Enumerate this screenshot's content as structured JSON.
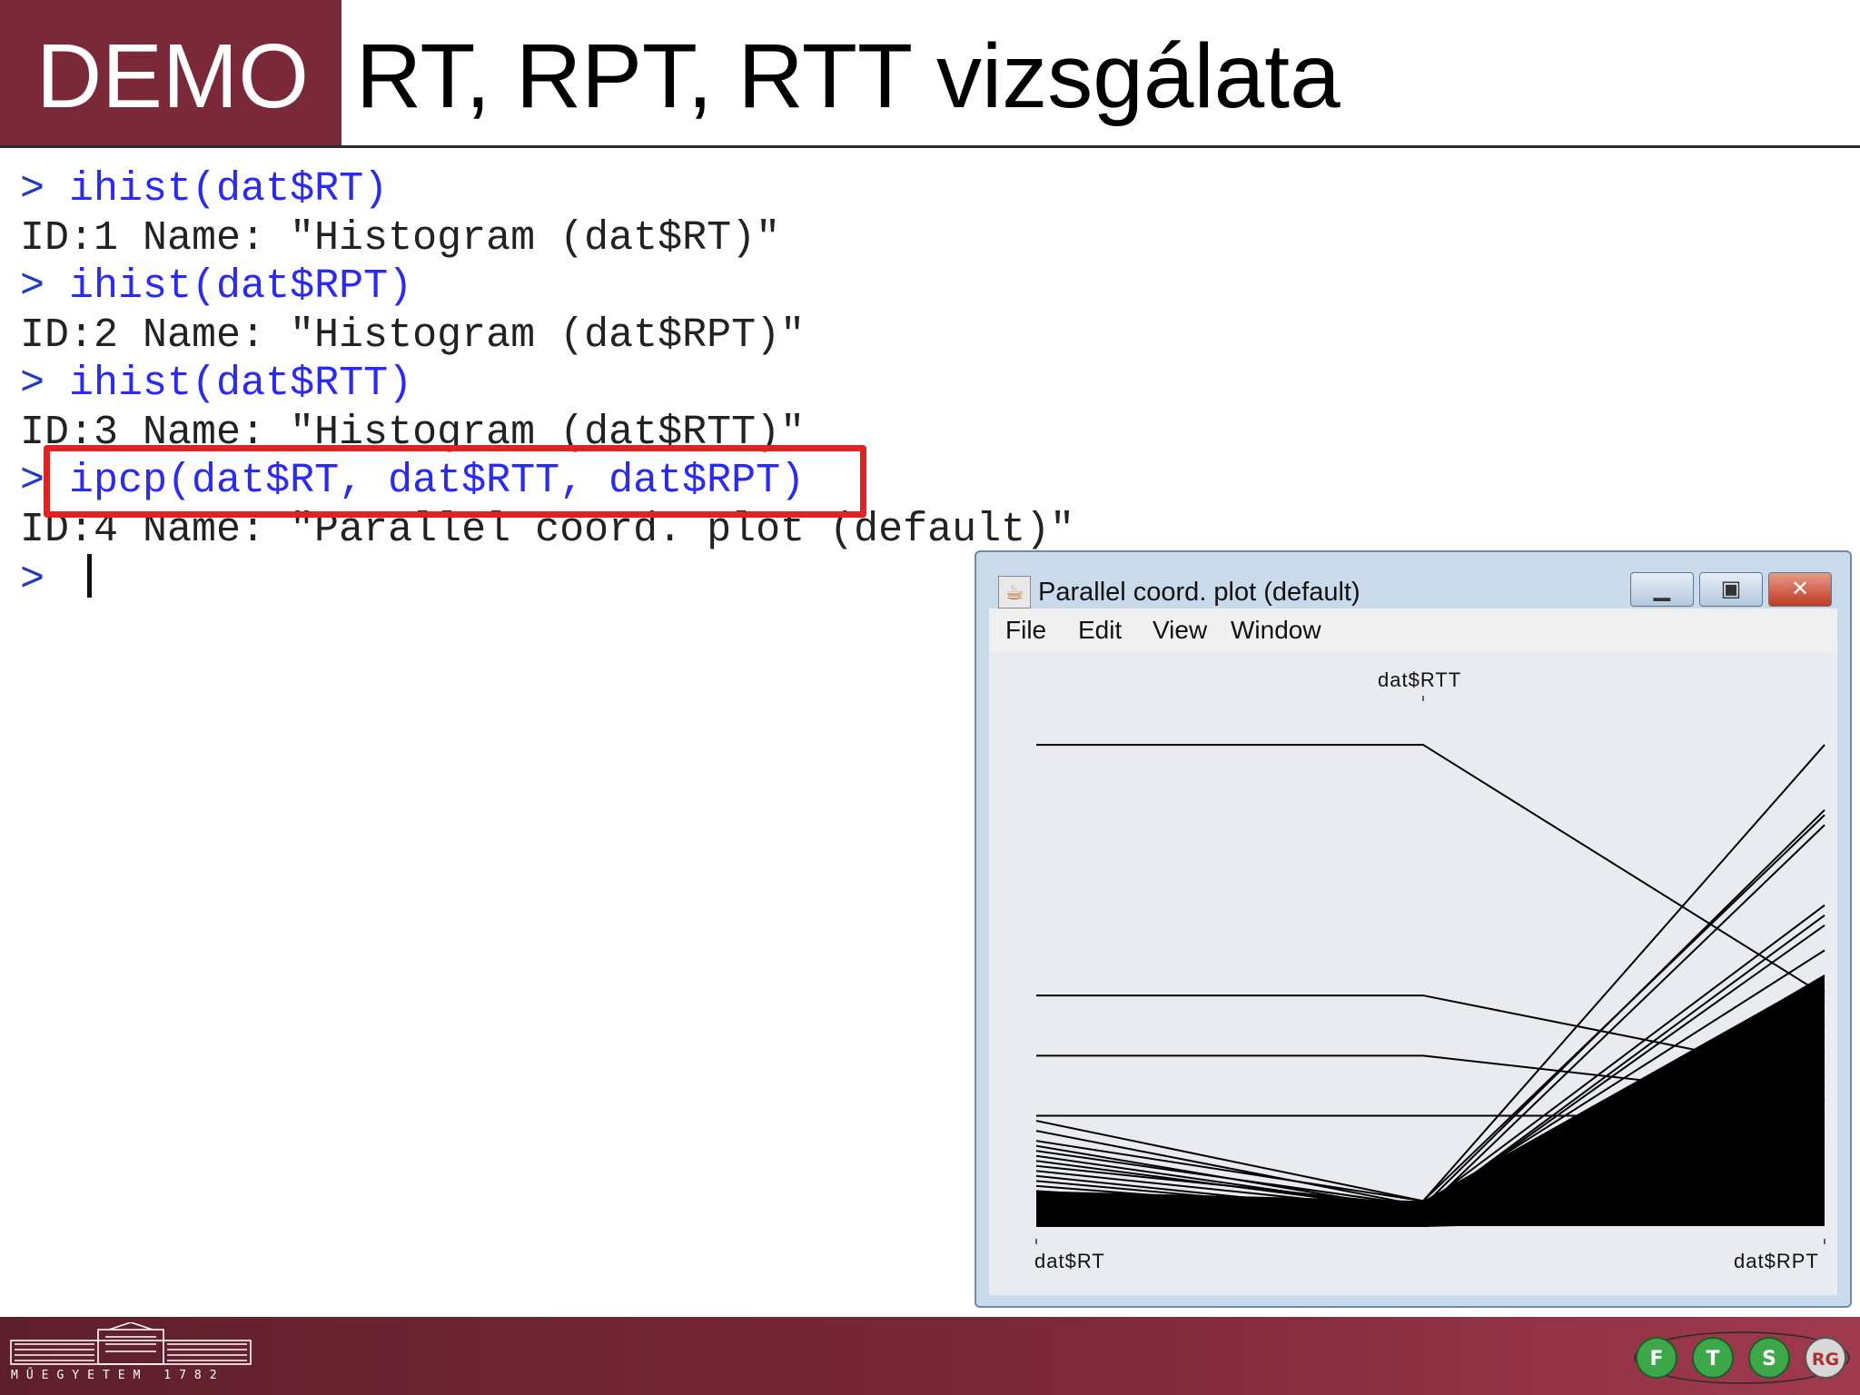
{
  "header": {
    "demo_label": "DEMO",
    "title": "RT, RPT, RTT vizsgálata"
  },
  "console": {
    "prompt": ">",
    "lines": [
      {
        "kind": "cmd",
        "text": "ihist(dat$RT)"
      },
      {
        "kind": "out",
        "text": "ID:1 Name: \"Histogram (dat$RT)\""
      },
      {
        "kind": "cmd",
        "text": "ihist(dat$RPT)"
      },
      {
        "kind": "out",
        "text": "ID:2 Name: \"Histogram (dat$RPT)\""
      },
      {
        "kind": "cmd",
        "text": "ihist(dat$RTT)"
      },
      {
        "kind": "out",
        "text": "ID:3 Name: \"Histogram (dat$RTT)\""
      },
      {
        "kind": "cmd",
        "text": "ipcp(dat$RT, dat$RTT, dat$RPT)"
      },
      {
        "kind": "out",
        "text": "ID:4 Name: \"Parallel coord. plot (default)\""
      },
      {
        "kind": "cmd",
        "text": ""
      }
    ],
    "highlight_color": "#e02222"
  },
  "window": {
    "title": "Parallel coord. plot (default)",
    "icon": "java-cup-icon",
    "buttons": {
      "minimize": "minimize-icon",
      "maximize": "maximize-icon",
      "close": "close-icon"
    },
    "menu": [
      "File",
      "Edit",
      "View",
      "Window"
    ]
  },
  "chart_data": {
    "type": "parallel-coordinates",
    "axes": [
      "dat$RT",
      "dat$RTT",
      "dat$RPT"
    ],
    "axis_label_positions": [
      "bottom",
      "top",
      "bottom"
    ],
    "value_scale": "relative 0-1 (min to max of each axis)",
    "grid": false,
    "legend": "none",
    "series_color": "#000000",
    "lines": [
      [
        0.96,
        0.96,
        0.46
      ],
      [
        0.46,
        0.46,
        0.3
      ],
      [
        0.34,
        0.34,
        0.25
      ],
      [
        0.22,
        0.22,
        0.22
      ],
      [
        0.21,
        0.05,
        0.96
      ],
      [
        0.19,
        0.04,
        0.83
      ],
      [
        0.17,
        0.05,
        0.82
      ],
      [
        0.16,
        0.03,
        0.8
      ],
      [
        0.15,
        0.04,
        0.64
      ],
      [
        0.14,
        0.03,
        0.62
      ],
      [
        0.13,
        0.03,
        0.6
      ],
      [
        0.12,
        0.04,
        0.55
      ],
      [
        0.11,
        0.03,
        0.5
      ],
      [
        0.1,
        0.02,
        0.47
      ],
      [
        0.09,
        0.02,
        0.45
      ],
      [
        0.08,
        0.02,
        0.42
      ],
      [
        0.07,
        0.02,
        0.4
      ],
      [
        0.06,
        0.01,
        0.38
      ],
      [
        0.05,
        0.01,
        0.35
      ],
      [
        0.04,
        0.01,
        0.32
      ],
      [
        0.03,
        0.01,
        0.3
      ],
      [
        0.02,
        0.01,
        0.28
      ],
      [
        0.02,
        0.0,
        0.25
      ],
      [
        0.01,
        0.0,
        0.22
      ],
      [
        0.01,
        0.0,
        0.2
      ],
      [
        0.0,
        0.0,
        0.18
      ],
      [
        0.0,
        0.0,
        0.15
      ],
      [
        0.0,
        0.0,
        0.12
      ],
      [
        0.0,
        0.0,
        0.1
      ],
      [
        0.0,
        0.0,
        0.07
      ],
      [
        0.0,
        0.0,
        0.05
      ],
      [
        0.0,
        0.0,
        0.02
      ]
    ]
  },
  "footer": {
    "logo": "university-building-logo",
    "logo_text": "MŰEGYETEM 1782",
    "badge": "ftsrg-logo",
    "badge_letters": [
      "F",
      "T",
      "S",
      "RG"
    ],
    "color": "#7b2838"
  }
}
